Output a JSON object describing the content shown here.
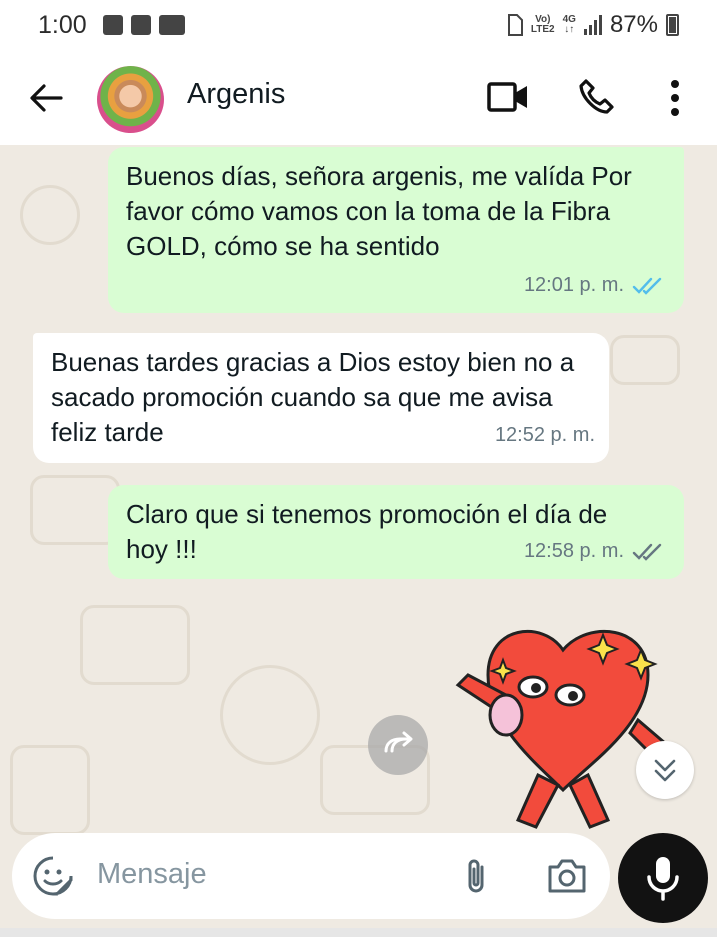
{
  "status_bar": {
    "time": "1:00",
    "network_top": "Vo)",
    "network_bottom": "LTE2",
    "data_top": "4G",
    "data_bottom": "↓↑",
    "battery": "87%"
  },
  "header": {
    "contact_name": "Argenis"
  },
  "messages": [
    {
      "direction": "out",
      "text": "Buenos días, señora argenis, me valída Por favor cómo vamos con la toma de la Fibra GOLD, cómo se ha sentido",
      "time": "12:01 p. m.",
      "status": "read"
    },
    {
      "direction": "in",
      "text": "Buenas tardes gracias a Dios estoy bien no a sacado promoción cuando sa que me  avisa feliz tarde",
      "time": "12:52 p. m."
    },
    {
      "direction": "out",
      "text": "Claro que si tenemos promoción el día de hoy !!!",
      "time": "12:58 p. m.",
      "status": "delivered"
    }
  ],
  "composer": {
    "placeholder": "Mensaje"
  },
  "colors": {
    "outgoing_bubble": "#d9fdd3",
    "incoming_bubble": "#ffffff",
    "chat_background": "#efeae2",
    "read_ticks": "#53bdeb",
    "delivered_ticks": "#667781",
    "mic_button": "#121212"
  },
  "icons": [
    "back-arrow-icon",
    "video-call-icon",
    "phone-icon",
    "more-options-icon",
    "forward-icon",
    "double-chevron-down-icon",
    "sticker-icon",
    "attach-icon",
    "camera-icon",
    "mic-icon"
  ]
}
